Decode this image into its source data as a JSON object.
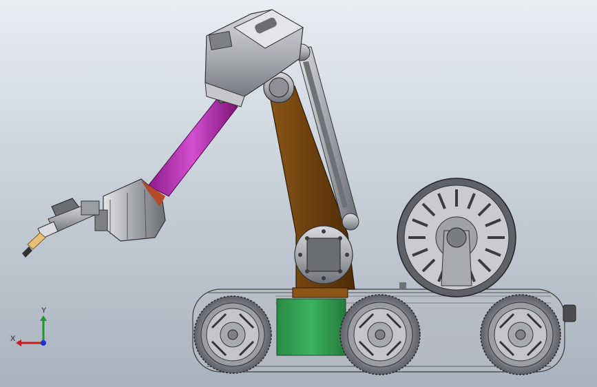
{
  "viewport": {
    "background_top": "#e9edf2",
    "background_bottom": "#a9b3bf"
  },
  "model": {
    "arm_link_color": "#b52fb2",
    "boom_color": "#6d3f10",
    "body_accent_color": "#2f9a4f",
    "metal_color": "#8f9298"
  },
  "triad": {
    "x_label": "X",
    "y_label": "Y",
    "x_color": "#c41e1e",
    "y_color": "#1e9a2c",
    "z_color": "#1b2fd6"
  }
}
